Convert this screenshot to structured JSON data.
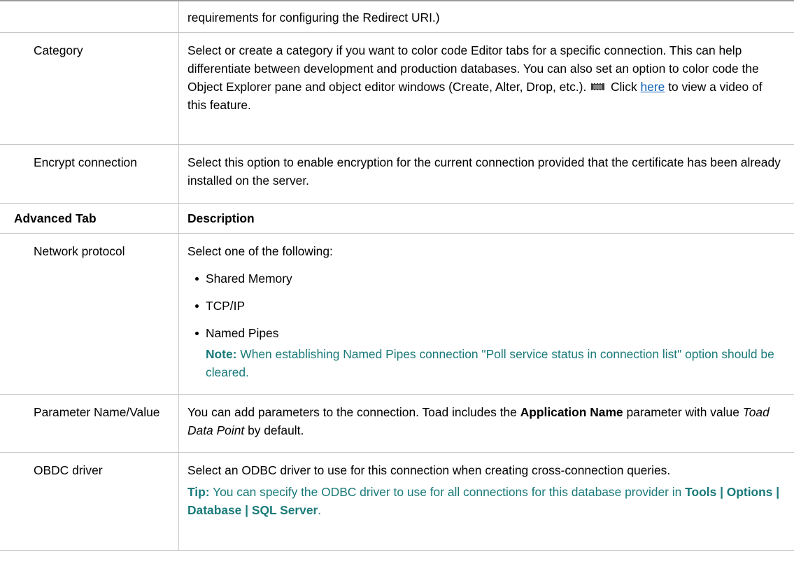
{
  "rows": {
    "redirect": {
      "text": "requirements for configuring the Redirect URI.)"
    },
    "category": {
      "label": "Category",
      "text_before": "Select or create a category if you want to color code Editor tabs for a specific connection. This can help differentiate between development and production databases. You can also set an option to color code the Object Explorer pane and object editor windows (Create, Alter, Drop, etc.).",
      "click_text": "Click",
      "link_text": "here",
      "text_after": "to view a video of this feature."
    },
    "encrypt": {
      "label": "Encrypt connection",
      "text": "Select this option to enable encryption for the current connection provided that the certificate has been already installed on the server."
    },
    "header": {
      "col1": "Advanced Tab",
      "col2": "Description"
    },
    "network": {
      "label": "Network protocol",
      "intro": "Select one of the following:",
      "options": [
        "Shared Memory",
        "TCP/IP",
        "Named Pipes"
      ],
      "note_label": "Note:",
      "note_text": "When establishing Named Pipes connection \"Poll service status in connection list\" option should be cleared."
    },
    "parameter": {
      "label": "Parameter Name/Value",
      "text1": "You can add parameters to the connection. Toad includes the",
      "bold": "Application Name",
      "text2": "parameter with value",
      "italic": "Toad Data Point",
      "text3": "by default."
    },
    "odbc": {
      "label": "OBDC driver",
      "text": "Select an ODBC driver to use for this connection when creating cross-connection queries.",
      "tip_label": "Tip:",
      "tip_text": "You can specify the ODBC driver to use for all connections for this database provider in",
      "tip_path": "Tools | Options | Database | SQL Server",
      "tip_end": "."
    }
  },
  "icons": {
    "video": "video-icon"
  },
  "colors": {
    "note": "#1a7a7a",
    "link": "#0b5fb5",
    "border": "#c9c9c9"
  }
}
